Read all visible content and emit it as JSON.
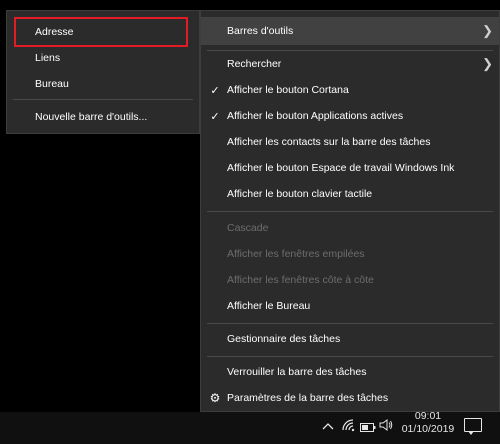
{
  "submenu": {
    "items": [
      {
        "label": "Adresse"
      },
      {
        "label": "Liens"
      },
      {
        "label": "Bureau"
      }
    ],
    "new_toolbar": "Nouvelle barre d'outils..."
  },
  "main_menu": {
    "toolbars": "Barres d'outils",
    "search": "Rechercher",
    "show_cortana": "Afficher le bouton Cortana",
    "show_task_view": "Afficher le bouton Applications actives",
    "show_contacts": "Afficher les contacts sur la barre des tâches",
    "show_ink": "Afficher le bouton Espace de travail Windows Ink",
    "show_keyboard": "Afficher le bouton clavier tactile",
    "cascade": "Cascade",
    "stacked": "Afficher les fenêtres empilées",
    "side_by_side": "Afficher les fenêtres côte à côte",
    "show_desktop": "Afficher le Bureau",
    "task_manager": "Gestionnaire des tâches",
    "lock_taskbar": "Verrouiller la barre des tâches",
    "taskbar_settings": "Paramètres de la barre des tâches",
    "check_glyph": "✓",
    "gear_glyph": "⚙",
    "chevron_glyph": "❯"
  },
  "taskbar": {
    "time": "09:01",
    "date": "01/10/2019",
    "icons": [
      "chevron-up-icon",
      "wifi-icon",
      "battery-icon",
      "volume-icon",
      "notification-icon"
    ]
  },
  "colors": {
    "menu_bg": "#2b2b2b",
    "highlight_border": "#e21b24",
    "hover_bg": "#414141",
    "disabled_text": "#6d6d6d"
  }
}
